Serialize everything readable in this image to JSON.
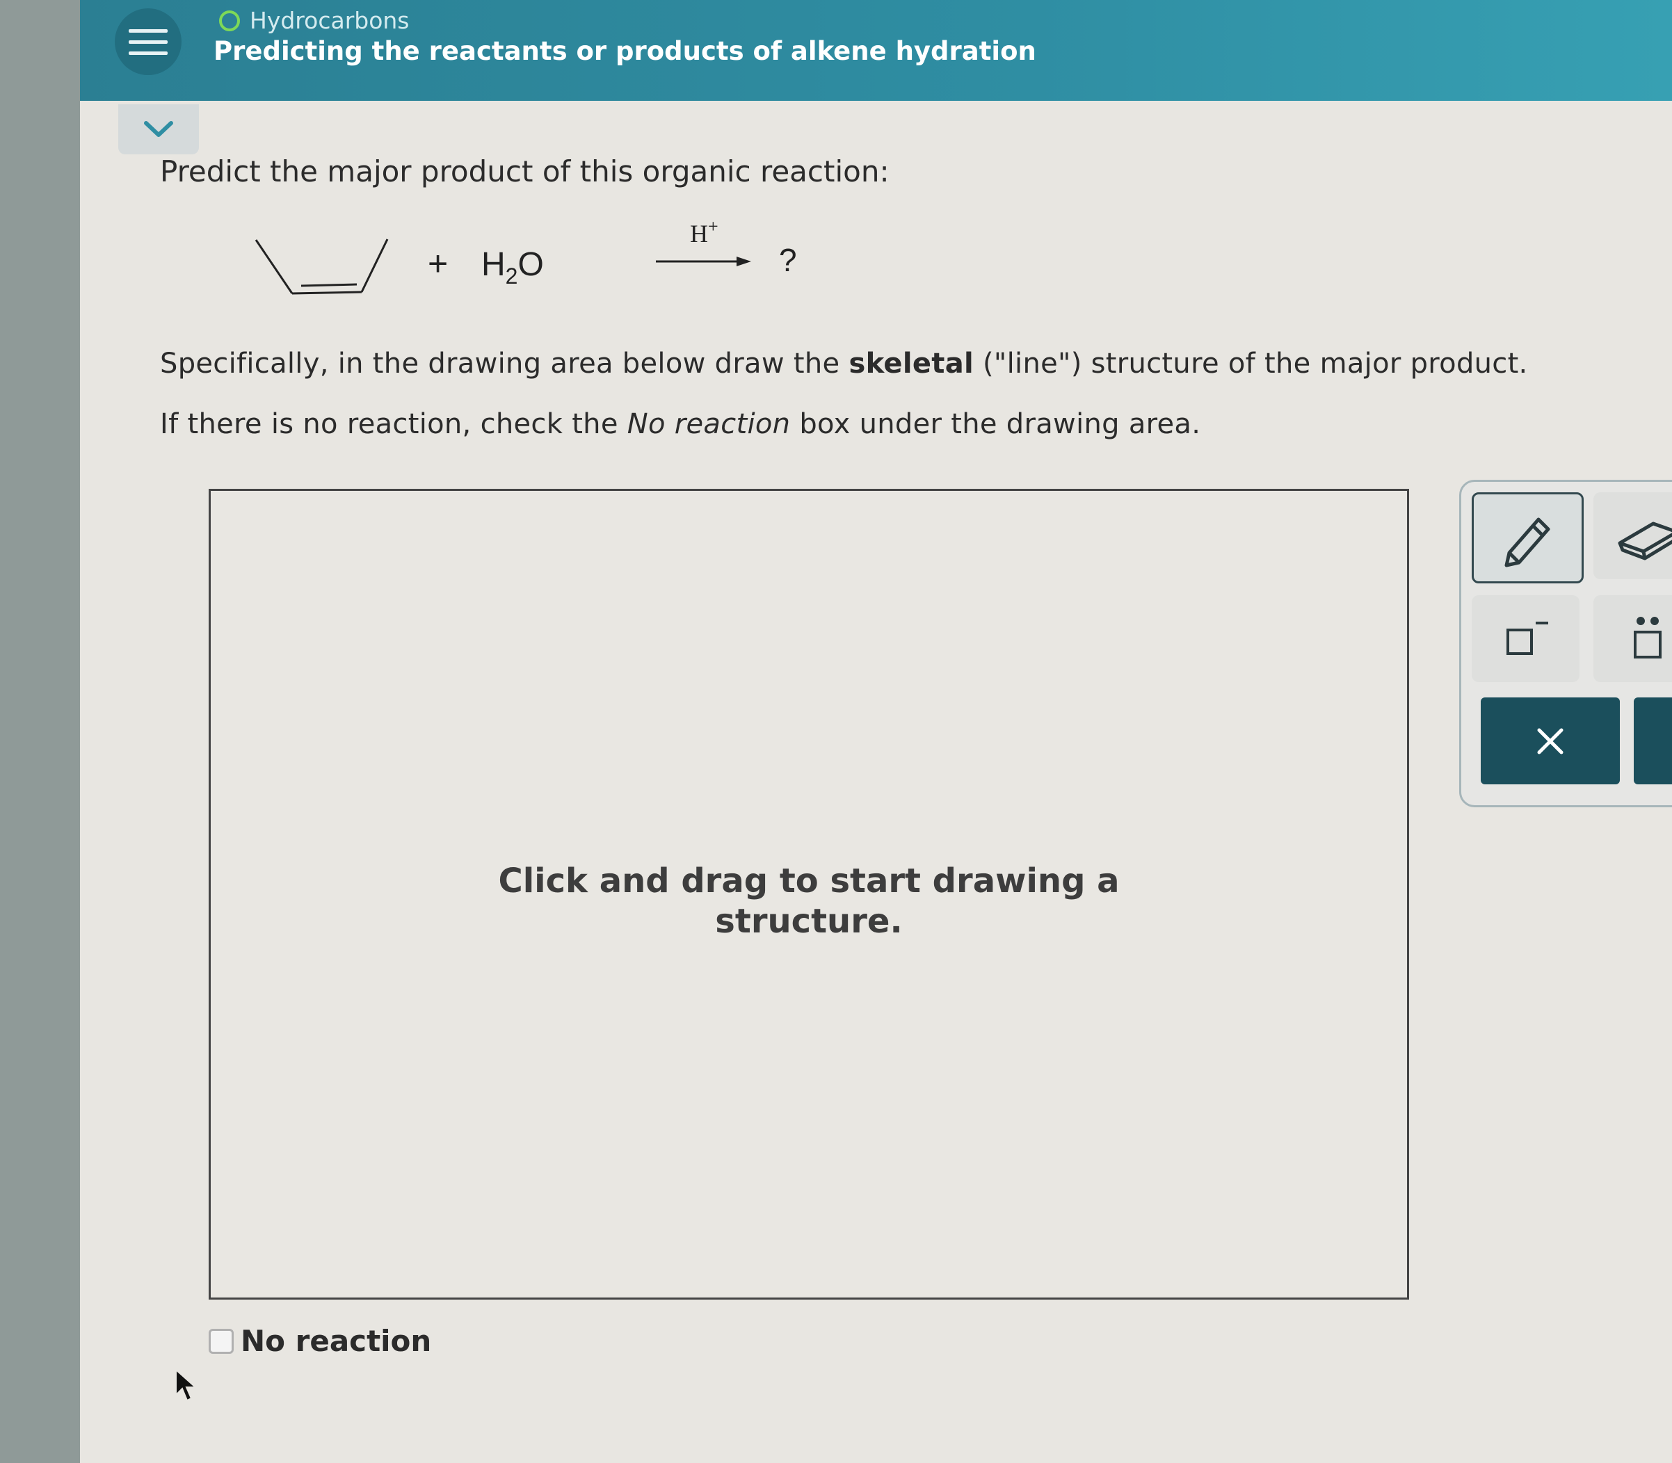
{
  "header": {
    "topic": "Hydrocarbons",
    "title": "Predicting the reactants or products of alkene hydration"
  },
  "question": {
    "prompt": "Predict the major product of this organic reaction:",
    "reaction": {
      "plus": "+",
      "reagent": "H",
      "reagent_sub": "2",
      "reagent_tail": "O",
      "catalyst": "H",
      "catalyst_sup": "+",
      "product": "?"
    },
    "instruction_pre": "Specifically, in the drawing area below draw the ",
    "instruction_bold": "skeletal",
    "instruction_post": " (\"line\") structure of the major product.",
    "no_reaction_pre": "If there is no reaction, check the ",
    "no_reaction_italic": "No reaction",
    "no_reaction_post": " box under the drawing area."
  },
  "drawing": {
    "hint": "Click and drag to start drawing a structure."
  },
  "no_reaction_checkbox": {
    "label": "No reaction",
    "checked": false
  },
  "toolbar": {
    "tools": [
      "pencil-icon",
      "eraser-icon",
      "charge-icon",
      "lone-pair-icon"
    ],
    "clear_icon": "x-icon"
  },
  "colors": {
    "header": "#2f8ea3",
    "accent_dark": "#1b4f5c",
    "status_dot": "#7ed957"
  }
}
